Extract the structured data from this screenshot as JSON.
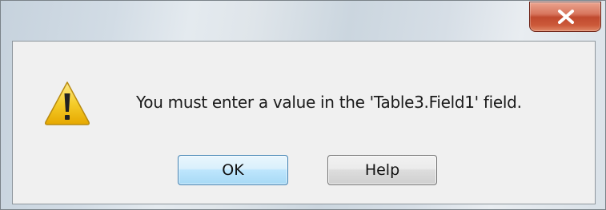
{
  "dialog": {
    "close_button_label": "x",
    "message": "You must enter a value in the 'Table3.Field1' field.",
    "icon": "warning-icon"
  },
  "buttons": {
    "ok_label": "OK",
    "help_label": "Help"
  },
  "colors": {
    "close_button": "#c74b2e",
    "ok_button_border": "#3c7fb1",
    "warning_icon": "#f3c619"
  }
}
